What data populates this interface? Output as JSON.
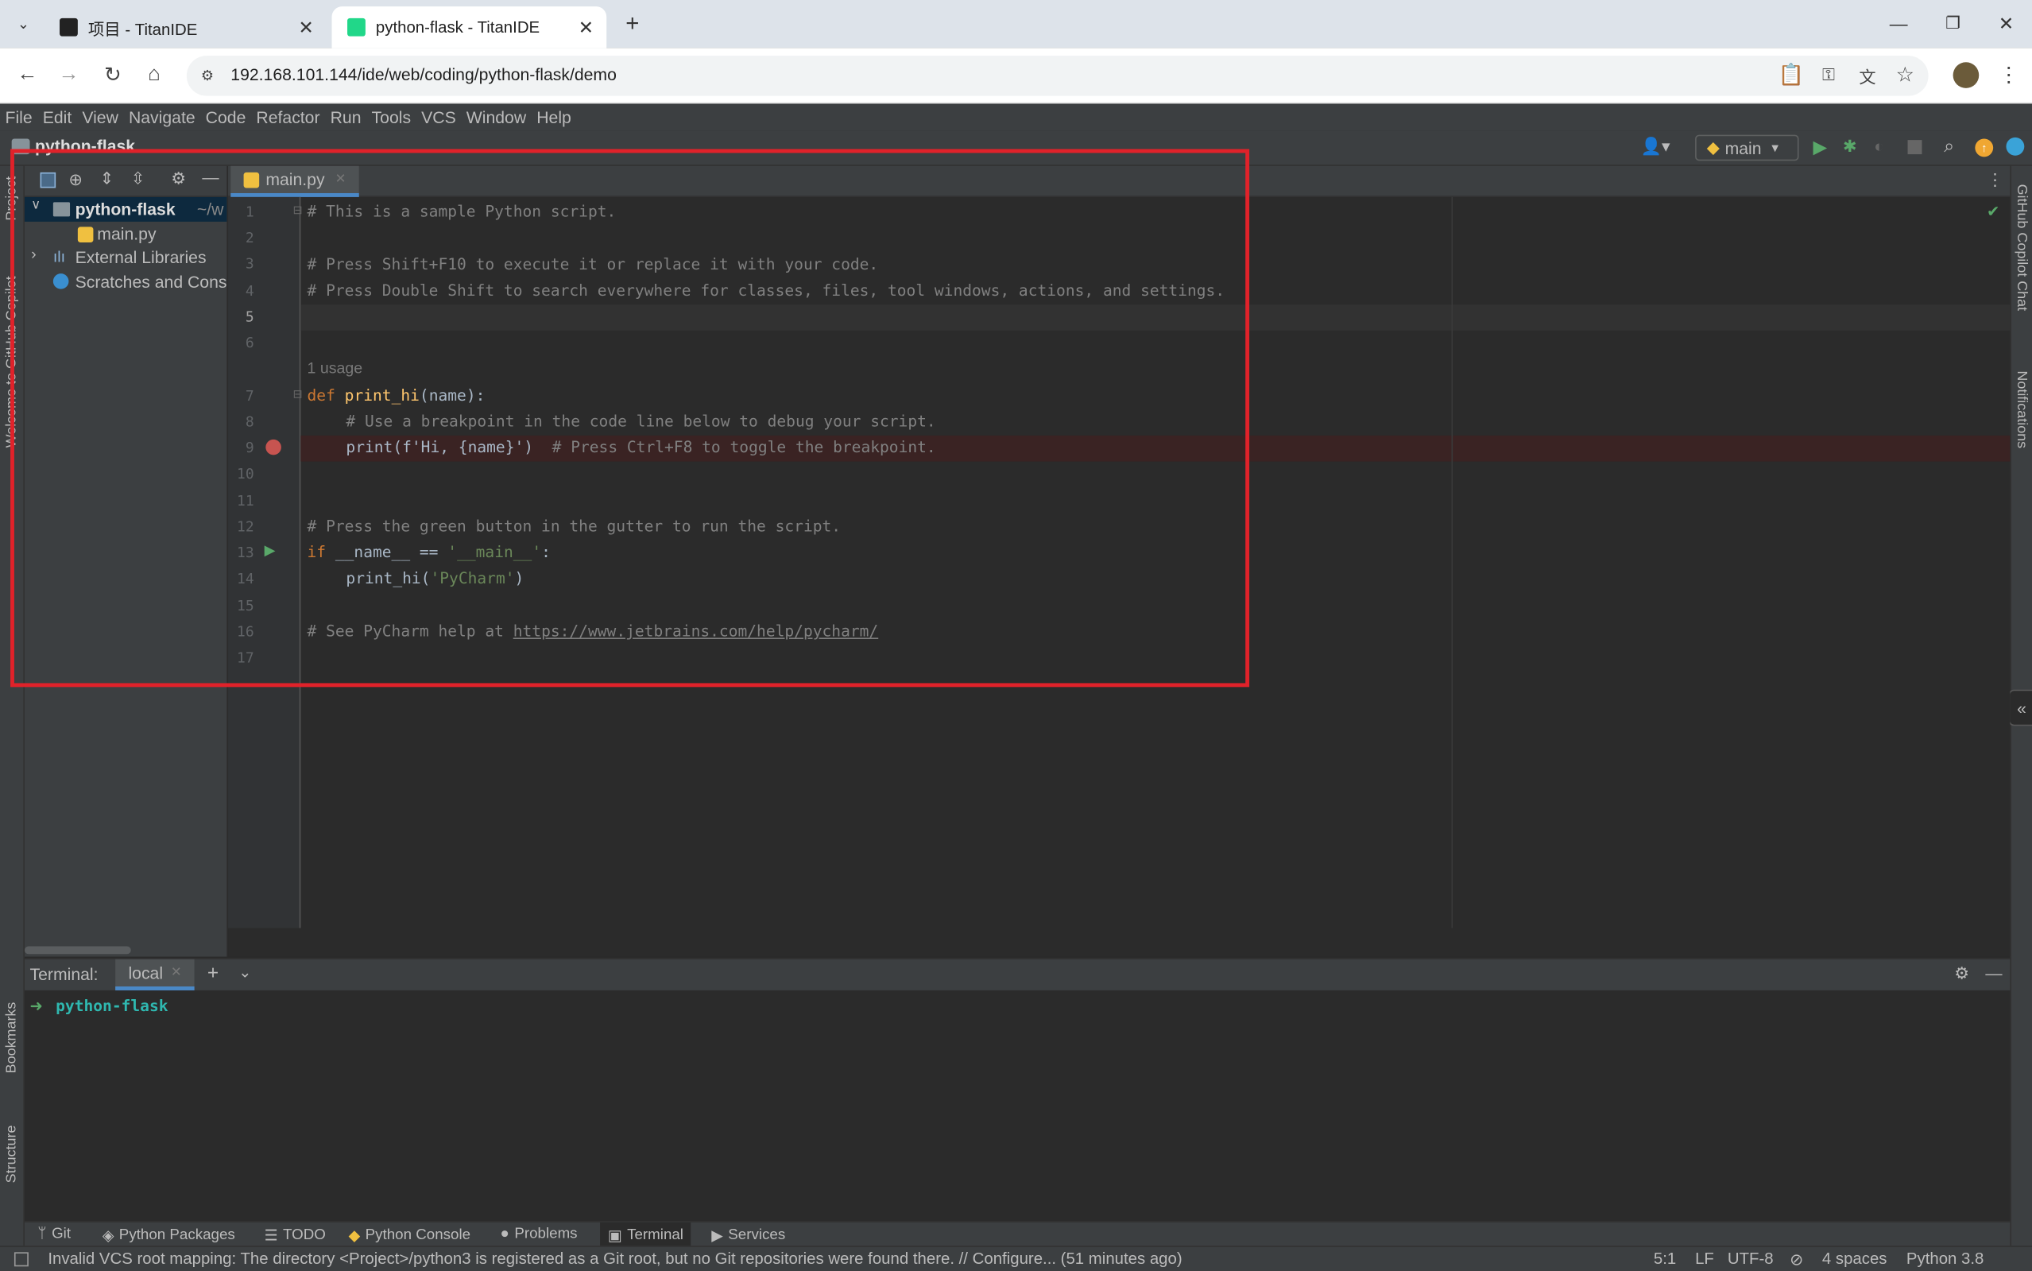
{
  "browser": {
    "tabs": [
      {
        "title": "项目 - TitanIDE"
      },
      {
        "title": "python-flask - TitanIDE"
      }
    ],
    "url": "192.168.101.144/ide/web/coding/python-flask/demo"
  },
  "menu": [
    "File",
    "Edit",
    "View",
    "Navigate",
    "Code",
    "Refactor",
    "Run",
    "Tools",
    "VCS",
    "Window",
    "Help"
  ],
  "navbar": {
    "project_name": "python-flask",
    "run_config": "main"
  },
  "side_left": {
    "project": "Project",
    "copilot": "Welcome to GitHub Copilot",
    "bookmarks": "Bookmarks",
    "structure": "Structure"
  },
  "side_right": {
    "copilot_chat": "GitHub Copilot Chat",
    "notifications": "Notifications"
  },
  "project_tree": {
    "root": "python-flask",
    "root_path": "~/w",
    "file": "main.py",
    "external": "External Libraries",
    "scratches": "Scratches and Consoles"
  },
  "editor": {
    "tab": "main.py",
    "line_numbers": [
      "1",
      "2",
      "3",
      "4",
      "5",
      "6",
      "7",
      "8",
      "9",
      "10",
      "11",
      "12",
      "13",
      "14",
      "15",
      "16",
      "17"
    ],
    "usage_hint": "1 usage",
    "lines": {
      "l1": "# This is a sample Python script.",
      "l3": "# Press Shift+F10 to execute it or replace it with your code.",
      "l4": "# Press Double Shift to search everywhere for classes, files, tool windows, actions, and settings.",
      "l7_kw": "def",
      "l7_fn": "print_hi",
      "l7_rest": "(name):",
      "l8": "# Use a breakpoint in the code line below to debug your script.",
      "l9_code": "print(f'Hi, {name}')",
      "l9_comment": "# Press Ctrl+F8 to toggle the breakpoint.",
      "l12": "# Press the green button in the gutter to run the script.",
      "l13_kw": "if",
      "l13_mid": "__name__ ==",
      "l13_str": "'__main__'",
      "l13_end": ":",
      "l14_call": "print_hi(",
      "l14_str": "'PyCharm'",
      "l14_end": ")",
      "l16_text": "# See PyCharm help at",
      "l16_link": "https://www.jetbrains.com/help/pycharm/"
    }
  },
  "terminal": {
    "label": "Terminal:",
    "tab": "local",
    "prompt": "python-flask"
  },
  "toolwindows": [
    "Git",
    "Python Packages",
    "TODO",
    "Python Console",
    "Problems",
    "Terminal",
    "Services"
  ],
  "status": {
    "message": "Invalid VCS root mapping: The directory <Project>/python3 is registered as a Git root, but no Git repositories were found there. // Configure... (51 minutes ago)",
    "position": "5:1",
    "line_sep": "LF",
    "encoding": "UTF-8",
    "indent": "4 spaces",
    "interpreter": "Python 3.8"
  },
  "colors": {
    "accent": "#4a88c7",
    "highlight_box": "#e0222a",
    "breakpoint": "#c75450",
    "run": "#59a869"
  }
}
